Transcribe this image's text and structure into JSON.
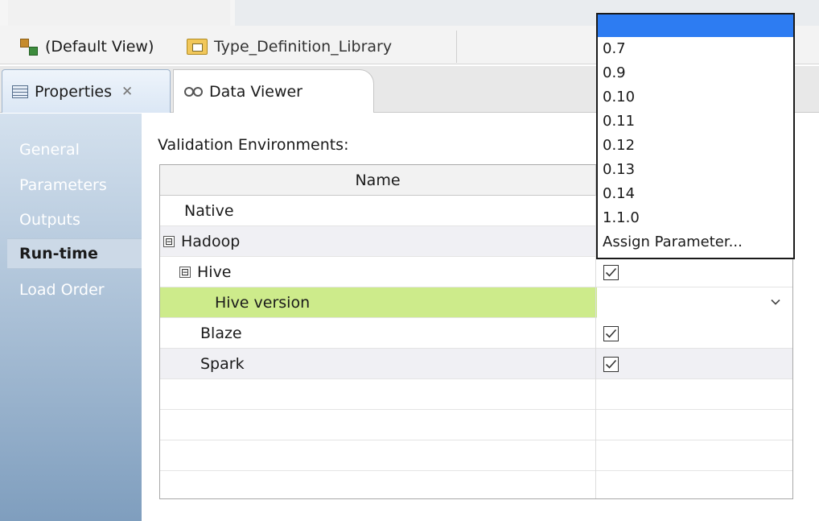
{
  "editor_tabs": [
    {
      "label": "(Default View)",
      "icon": "mapping-icon"
    },
    {
      "label": "Type_Definition_Library",
      "icon": "library-icon"
    }
  ],
  "property_tabs": [
    {
      "label": "Properties",
      "icon": "properties-icon",
      "active": true
    },
    {
      "label": "Data Viewer",
      "icon": "data-viewer-icon",
      "active": false
    }
  ],
  "nav": {
    "items": [
      "General",
      "Parameters",
      "Outputs",
      "Run-time",
      "Load Order"
    ],
    "active": "Run-time"
  },
  "section_label": "Validation Environments:",
  "grid": {
    "header_name": "Name",
    "rows": [
      {
        "name": "Native",
        "checked": null
      },
      {
        "name": "Hadoop",
        "expander": "⊟",
        "checked": null
      },
      {
        "name": "Hive",
        "expander": "⊟",
        "checked": true
      },
      {
        "name": "Hive version",
        "checked": null,
        "dropdown": true,
        "selected": true
      },
      {
        "name": "Blaze",
        "checked": true
      },
      {
        "name": "Spark",
        "checked": true
      }
    ]
  },
  "dropdown_options": [
    "",
    "0.7",
    "0.9",
    "0.10",
    "0.11",
    "0.12",
    "0.13",
    "0.14",
    "1.1.0",
    "Assign Parameter..."
  ],
  "colors": {
    "selected_row": "#cdeb8b",
    "dropdown_highlight": "#2d7cf2",
    "nav_gradient_top": "#d4e1ee",
    "nav_gradient_bottom": "#7f9ebe"
  }
}
